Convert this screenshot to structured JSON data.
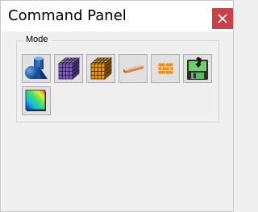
{
  "window": {
    "title": "Command Panel"
  },
  "mode_group": {
    "label": "Mode",
    "buttons": [
      {
        "icon": "primitives-icon"
      },
      {
        "icon": "purple-grid-cube-icon"
      },
      {
        "icon": "orange-grid-cube-icon"
      },
      {
        "icon": "plank-icon"
      },
      {
        "icon": "bricks-icon"
      },
      {
        "icon": "save-disk-icon"
      },
      {
        "icon": "color-gradient-icon"
      }
    ]
  },
  "colors": {
    "close_button": "#c8424a",
    "background": "#f0f0f0"
  }
}
